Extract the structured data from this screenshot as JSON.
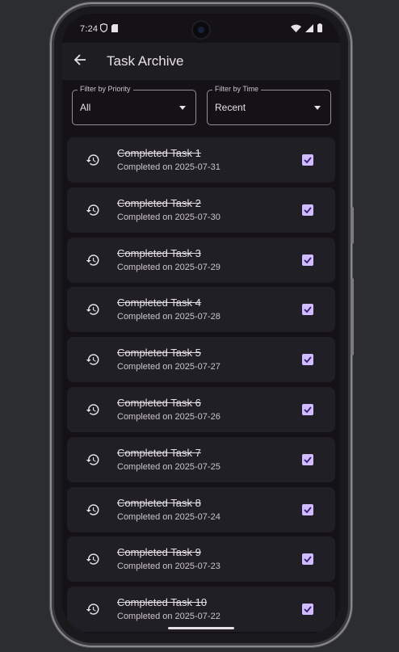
{
  "status_bar": {
    "time": "7:24"
  },
  "app_bar": {
    "title": "Task Archive"
  },
  "filters": [
    {
      "label": "Filter by Priority",
      "value": "All"
    },
    {
      "label": "Filter by Time",
      "value": "Recent"
    }
  ],
  "tasks": [
    {
      "title": "Completed Task 1",
      "date": "Completed on 2025-07-31",
      "checked": true
    },
    {
      "title": "Completed Task 2",
      "date": "Completed on 2025-07-30",
      "checked": true
    },
    {
      "title": "Completed Task 3",
      "date": "Completed on 2025-07-29",
      "checked": true
    },
    {
      "title": "Completed Task 4",
      "date": "Completed on 2025-07-28",
      "checked": true
    },
    {
      "title": "Completed Task 5",
      "date": "Completed on 2025-07-27",
      "checked": true
    },
    {
      "title": "Completed Task 6",
      "date": "Completed on 2025-07-26",
      "checked": true
    },
    {
      "title": "Completed Task 7",
      "date": "Completed on 2025-07-25",
      "checked": true
    },
    {
      "title": "Completed Task 8",
      "date": "Completed on 2025-07-24",
      "checked": true
    },
    {
      "title": "Completed Task 9",
      "date": "Completed on 2025-07-23",
      "checked": true
    },
    {
      "title": "Completed Task 10",
      "date": "Completed on 2025-07-22",
      "checked": true
    }
  ],
  "icons": {
    "back": "arrow-back-icon",
    "history": "history-icon",
    "check": "checkbox-checked-icon",
    "dropdown": "dropdown-arrow-icon"
  },
  "colors": {
    "background": "#141217",
    "surface": "#211f26",
    "accent": "#d0bcff",
    "text": "#e6e1e5",
    "secondary_text": "#cac4d0"
  }
}
